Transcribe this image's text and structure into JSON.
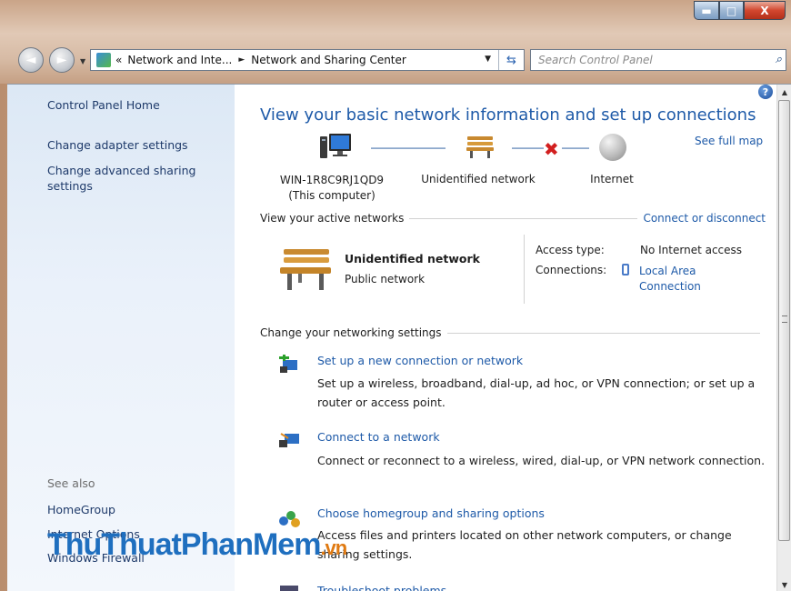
{
  "window": {
    "minimize_glyph": "▬",
    "maximize_glyph": "□",
    "close_glyph": "X"
  },
  "address_bar": {
    "prefix": "«",
    "crumbs": [
      "Network and Inte...",
      "Network and Sharing Center"
    ],
    "separator": "►"
  },
  "search": {
    "placeholder": "Search Control Panel"
  },
  "sidebar": {
    "links": [
      "Control Panel Home",
      "Change adapter settings",
      "Change advanced sharing settings"
    ],
    "see_also_title": "See also",
    "see_also": [
      "HomeGroup",
      "Internet Options",
      "Windows Firewall"
    ]
  },
  "main": {
    "title": "View your basic network information and set up connections",
    "see_full_map": "See full map",
    "map": {
      "computer_name": "WIN-1R8C9RJ1QD9",
      "computer_sub": "(This computer)",
      "network": "Unidentified network",
      "internet": "Internet"
    },
    "active_networks": {
      "header": "View your active networks",
      "action": "Connect or disconnect",
      "name": "Unidentified network",
      "type": "Public network",
      "access_type_label": "Access type:",
      "access_type_value": "No Internet access",
      "connections_label": "Connections:",
      "connections_value": "Local Area Connection"
    },
    "change_settings": {
      "header": "Change your networking settings",
      "tasks": [
        {
          "link": "Set up a new connection or network",
          "desc": "Set up a wireless, broadband, dial-up, ad hoc, or VPN connection; or set up a router or access point."
        },
        {
          "link": "Connect to a network",
          "desc": "Connect or reconnect to a wireless, wired, dial-up, or VPN network connection."
        },
        {
          "link": "Choose homegroup and sharing options",
          "desc": "Access files and printers located on other network computers, or change sharing settings."
        },
        {
          "link": "Troubleshoot problems"
        }
      ]
    }
  },
  "watermark": {
    "main": "ThuThuatPhanMem",
    "suffix": ".vn"
  },
  "colors": {
    "link": "#1e5aa8",
    "title": "#1e5aa8",
    "sidebar_bg": "#dce8f5",
    "error_x": "#d21f1f"
  }
}
